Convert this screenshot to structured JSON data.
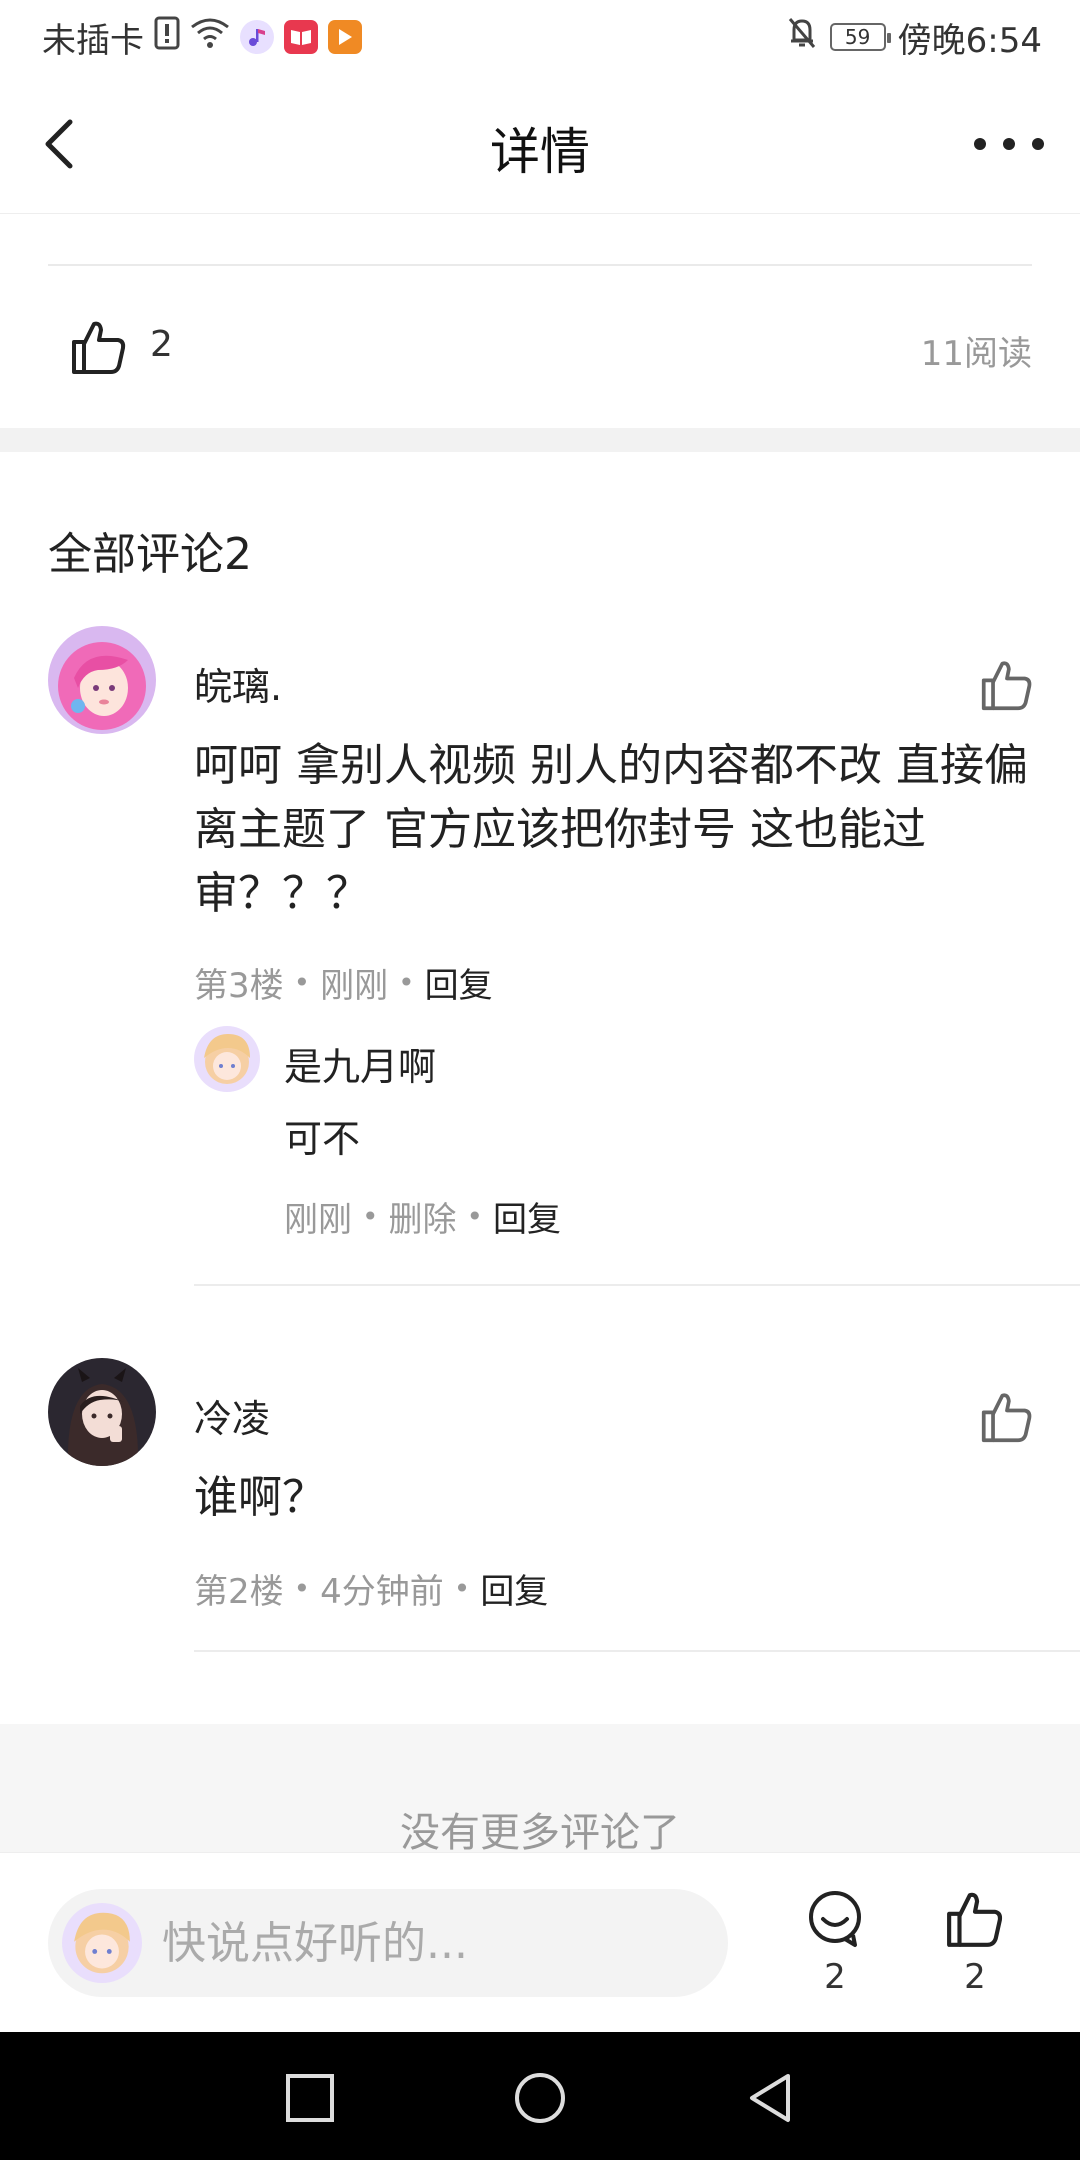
{
  "status_bar": {
    "carrier": "未插卡",
    "battery": "59",
    "time": "傍晚6:54",
    "icons": [
      "sim-alert-icon",
      "wifi-icon",
      "music-app-icon",
      "book-app-icon",
      "video-app-icon",
      "mute-bell-icon",
      "battery-icon"
    ]
  },
  "header": {
    "title": "详情",
    "back_icon": "back-arrow-icon",
    "more_icon": "more-dots-icon"
  },
  "post_stats": {
    "like_count": "2",
    "read_count": "11阅读"
  },
  "comments_section": {
    "title": "全部评论2",
    "end_text": "没有更多评论了",
    "comments": [
      {
        "name": "皖璃.",
        "text": "呵呵 拿别人视频  别人的内容都不改  直接偏离主题了 官方应该把你封号  这也能过审？？？",
        "floor": "第3楼",
        "time": "刚刚",
        "reply_label": "回复",
        "replies": [
          {
            "name": "是九月啊",
            "text": "可不",
            "time": "刚刚",
            "delete_label": "删除",
            "reply_label": "回复"
          }
        ]
      },
      {
        "name": "冷凌",
        "text": "谁啊？",
        "floor": "第2楼",
        "time": "4分钟前",
        "reply_label": "回复",
        "replies": []
      }
    ]
  },
  "input_bar": {
    "placeholder": "快说点好听的...",
    "comment_count": "2",
    "like_count": "2"
  },
  "colors": {
    "text_primary": "#222222",
    "text_secondary": "#999999",
    "background_band": "#f2f2f2",
    "nav_bar": "#000000"
  }
}
